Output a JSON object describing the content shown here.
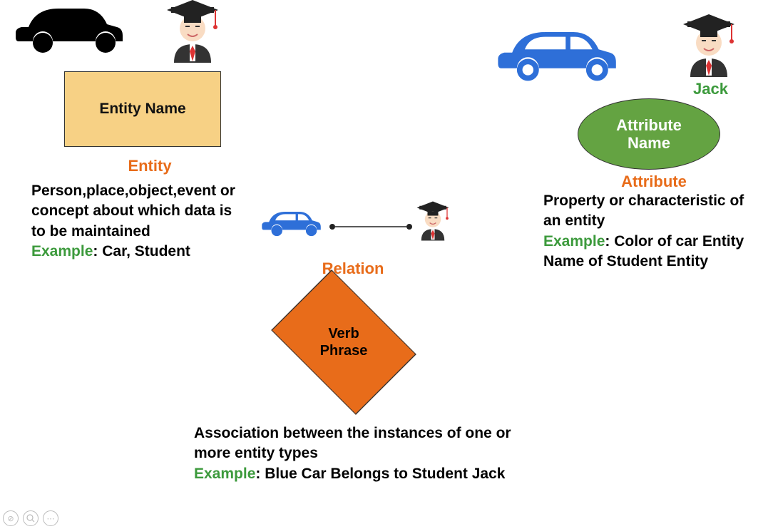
{
  "entity": {
    "shape_label": "Entity Name",
    "title": "Entity",
    "description": "Person,place,object,event or concept about which data is to be maintained",
    "example_prefix": "Example",
    "example_text": ": Car, Student"
  },
  "relation": {
    "shape_label": "Verb\nPhrase",
    "title": "Relation",
    "description": "Association between the instances of one or more entity types",
    "example_prefix": "Example",
    "example_text": ": Blue Car Belongs to Student Jack"
  },
  "attribute": {
    "shape_label": "Attribute\nName",
    "title": "Attribute",
    "student_name": "Jack",
    "description": "Property or characteristic of an entity",
    "example_prefix": "Example",
    "example_text": ": Color of car Entity Name of Student Entity"
  },
  "icons": {
    "car_black": "car-icon",
    "car_blue": "car-icon",
    "student": "student-icon"
  }
}
